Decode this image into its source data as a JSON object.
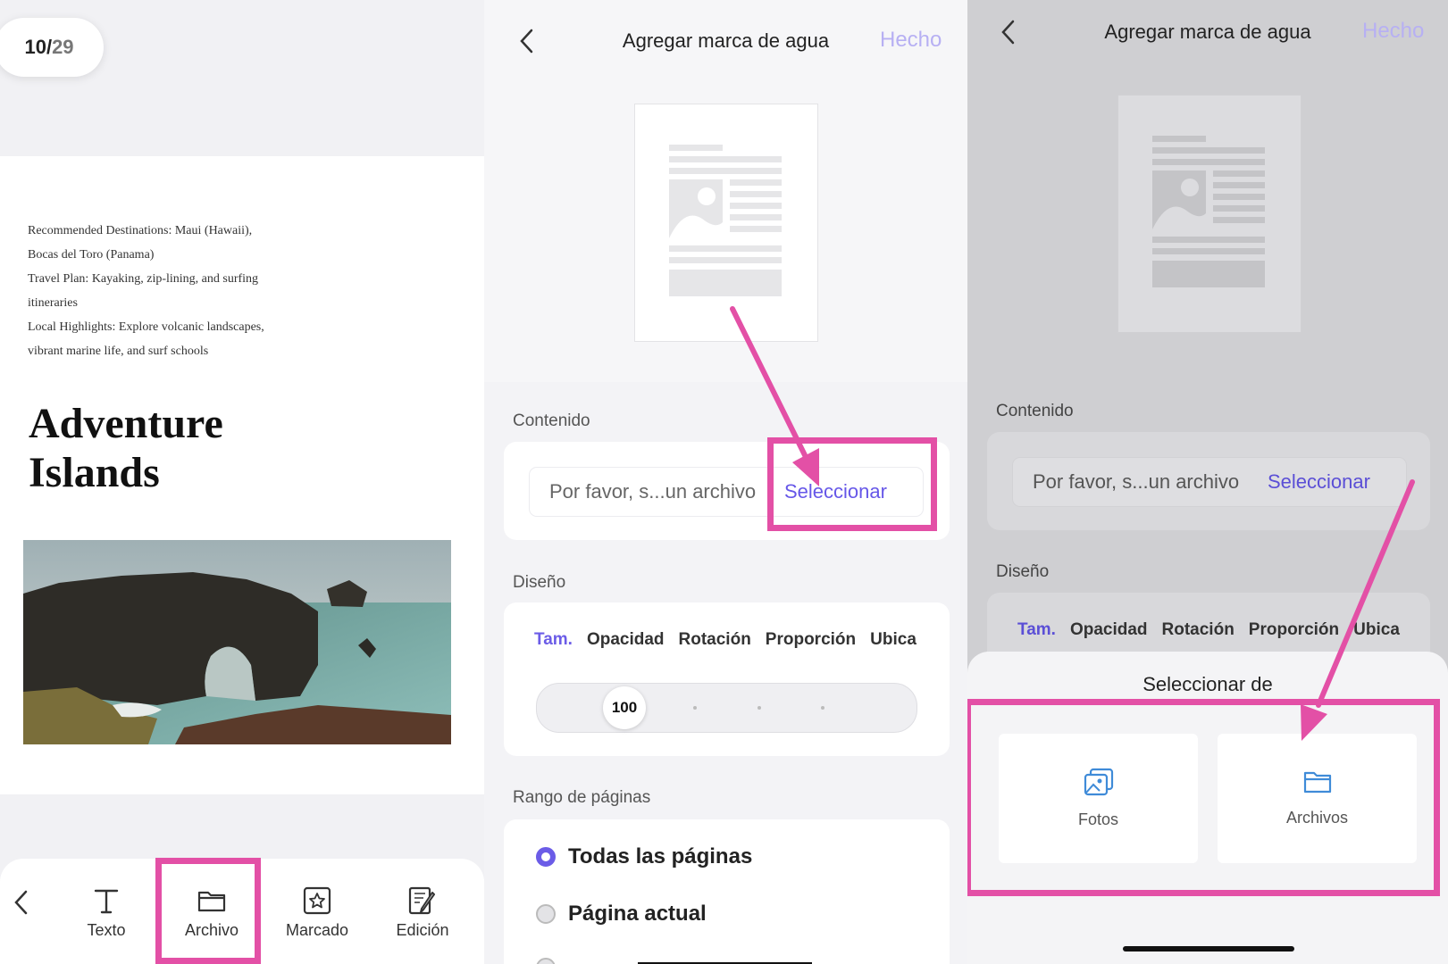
{
  "viewer": {
    "page_current": "10",
    "page_sep": " / ",
    "page_total": "29",
    "doc_lines": [
      "Recommended Destinations: Maui (Hawaii),",
      "Bocas del Toro (Panama)",
      "Travel Plan: Kayaking, zip-lining, and surfing",
      "itineraries",
      "Local Highlights: Explore volcanic landscapes,",
      "vibrant marine life, and surf schools"
    ],
    "title_line1": "Adventure",
    "title_line2": "Islands",
    "toolbar": {
      "text": "Texto",
      "file": "Archivo",
      "mark": "Marcado",
      "edit": "Edición"
    }
  },
  "watermark": {
    "title": "Agregar marca de agua",
    "done": "Hecho",
    "content_label": "Contenido",
    "file_placeholder": "Por favor, s...un archivo",
    "select": "Seleccionar",
    "design_label": "Diseño",
    "tabs": [
      "Tam.",
      "Opacidad",
      "Rotación",
      "Proporción",
      "Ubica"
    ],
    "size_value": "100",
    "range_label": "Rango de páginas",
    "range_all": "Todas las páginas",
    "range_current": "Página actual"
  },
  "picker": {
    "title": "Seleccionar de",
    "photos": "Fotos",
    "files": "Archivos"
  },
  "colors": {
    "accent": "#6b5ce7",
    "highlight": "#e350a6"
  }
}
